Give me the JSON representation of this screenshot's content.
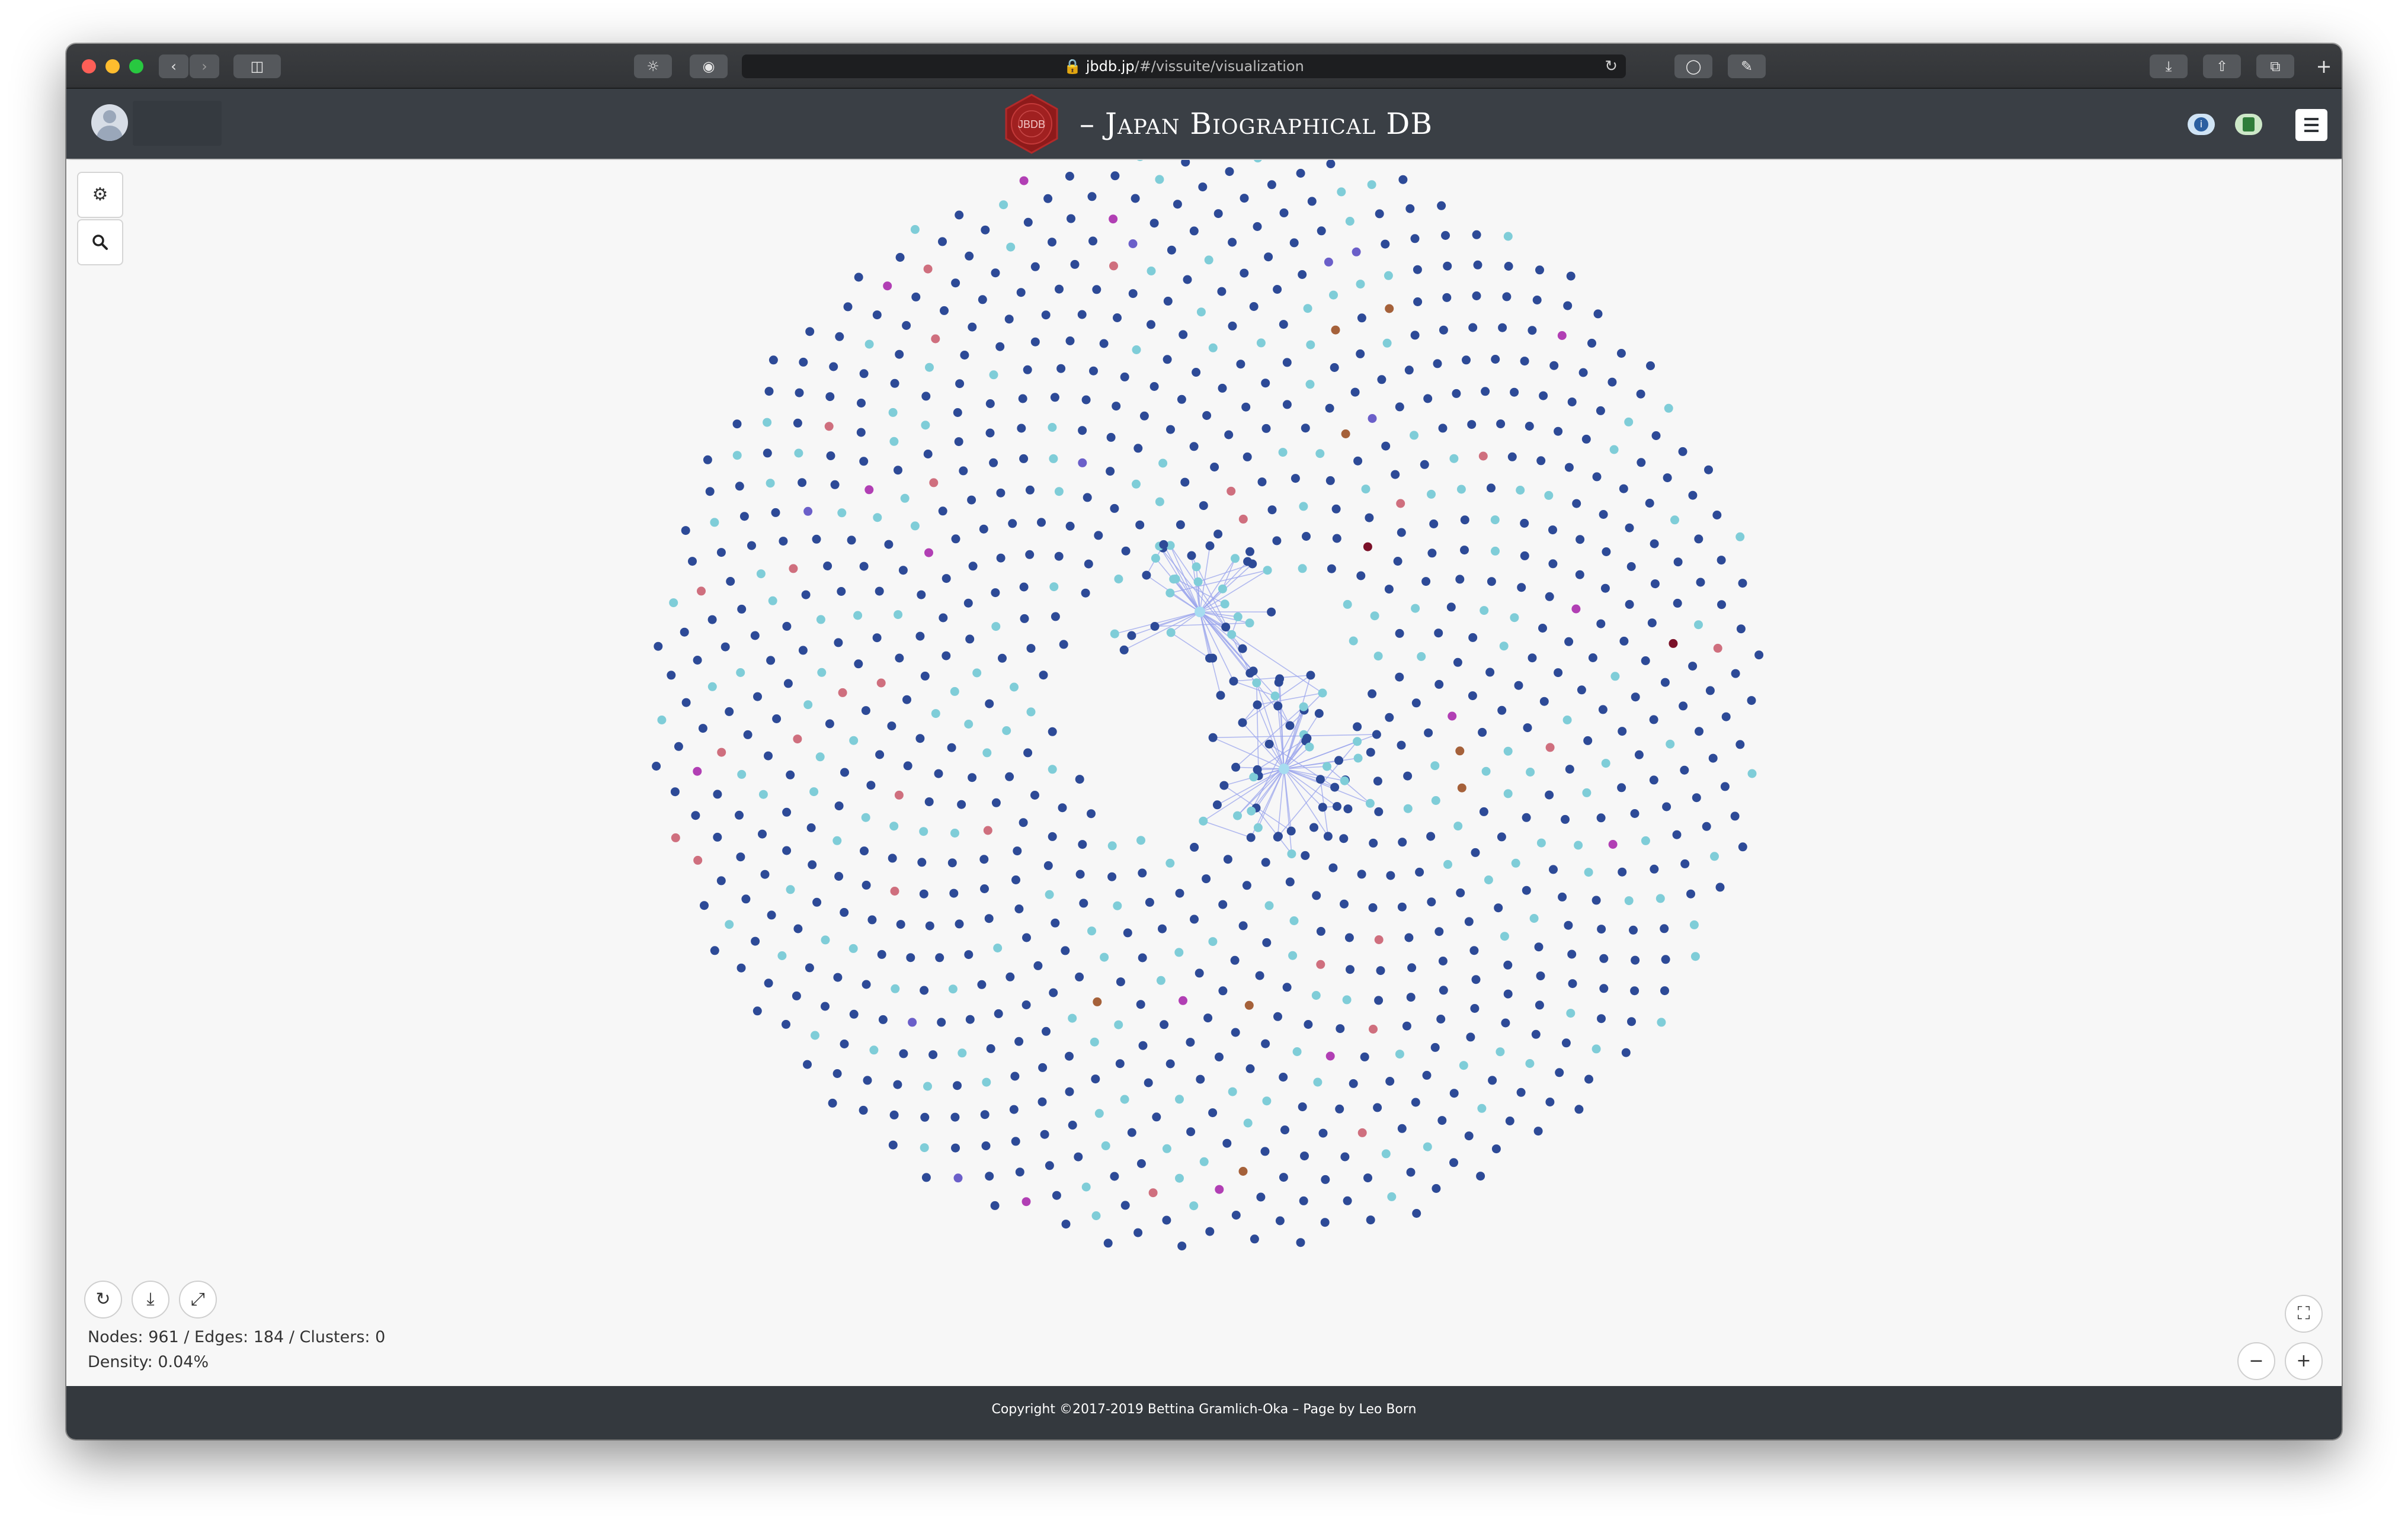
{
  "browser": {
    "url_host": "jbdb.jp",
    "url_path": "/#/vissuite/visualization"
  },
  "header": {
    "logo_text": "JBDB",
    "title": "– Japan Biographical DB"
  },
  "stats": {
    "nodes_edges": "Nodes: 961 / Edges: 184 / Clusters: 0",
    "density": "Density: 0.04%"
  },
  "footer": {
    "copyright": "Copyright ©2017-2019 Bettina Gramlich-Oka – Page by Leo Born"
  },
  "graph": {
    "node_count": 961,
    "edge_count": 184,
    "clusters": 0,
    "colors": {
      "person": "#2d4a97",
      "light": "#7fcdd8",
      "rose": "#cf6f7e",
      "magenta": "#b13fb4",
      "violet": "#6b5fc9",
      "brown": "#a5613a",
      "maroon": "#7a1028",
      "edge": "#9aa4ec",
      "hub": "#a6dcf0"
    }
  },
  "icons": [
    "gear-icon",
    "search-icon",
    "refresh-icon",
    "download-icon",
    "expand-icon",
    "fit-screen-icon",
    "zoom-out-icon",
    "zoom-in-icon",
    "info-icon",
    "book-icon",
    "menu-icon",
    "avatar-icon"
  ]
}
